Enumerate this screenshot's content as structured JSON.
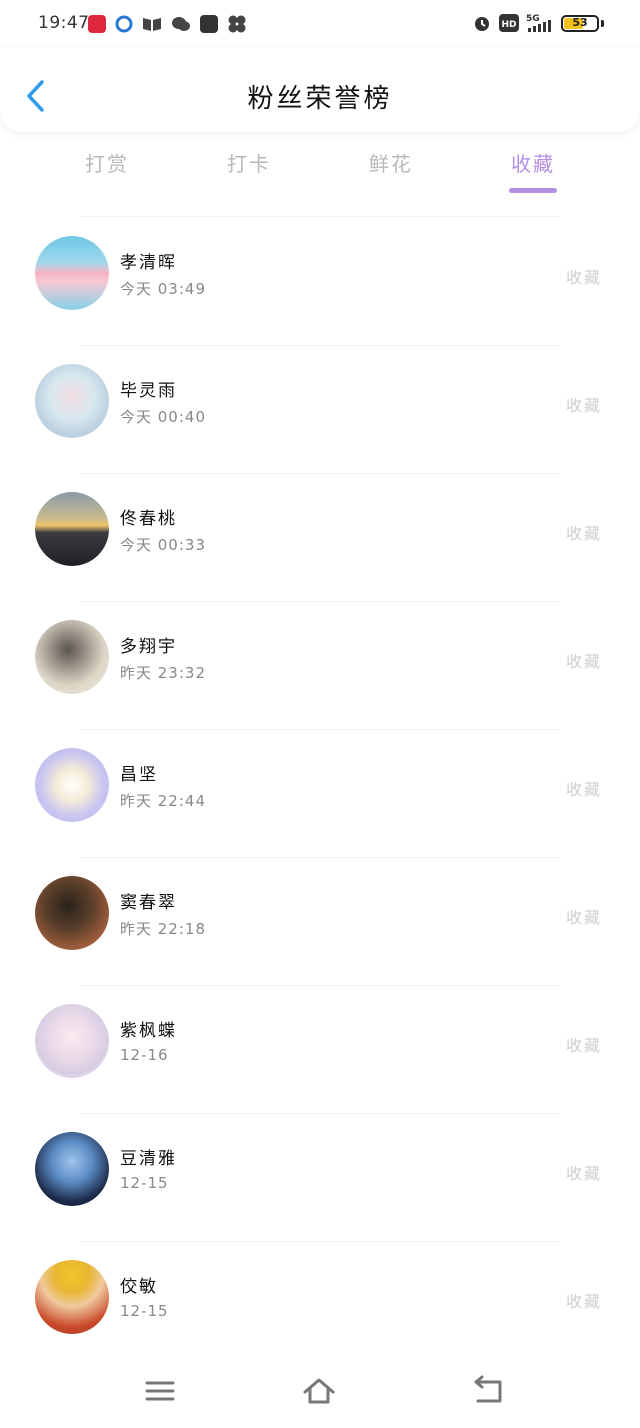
{
  "status_bar": {
    "time": "19:47",
    "left_icons": [
      "news-app-icon",
      "browser-icon",
      "book-icon",
      "wechat-icon",
      "music-icon",
      "fan-icon"
    ],
    "right_icons": [
      "alarm-icon",
      "hd-icon",
      "5g-signal-icon"
    ],
    "battery": "53"
  },
  "header": {
    "title": "粉丝荣誉榜"
  },
  "tabs": [
    {
      "label": "打赏",
      "active": false
    },
    {
      "label": "打卡",
      "active": false
    },
    {
      "label": "鲜花",
      "active": false
    },
    {
      "label": "收藏",
      "active": true
    }
  ],
  "list": [
    {
      "name": "孝清晖",
      "time": "今天 03:49",
      "action": "收藏"
    },
    {
      "name": "毕灵雨",
      "time": "今天 00:40",
      "action": "收藏"
    },
    {
      "name": "佟春桃",
      "time": "今天 00:33",
      "action": "收藏"
    },
    {
      "name": "多翔宇",
      "time": "昨天 23:32",
      "action": "收藏"
    },
    {
      "name": "昌坚",
      "time": "昨天 22:44",
      "action": "收藏"
    },
    {
      "name": "窦春翠",
      "time": "昨天 22:18",
      "action": "收藏"
    },
    {
      "name": "紫枫蝶",
      "time": "12-16",
      "action": "收藏"
    },
    {
      "name": "豆清雅",
      "time": "12-15",
      "action": "收藏"
    },
    {
      "name": "佼敏",
      "time": "12-15",
      "action": "收藏"
    }
  ],
  "colors": {
    "accent": "#b58fe3",
    "back": "#2f9bea",
    "muted": "#cfcfcf"
  },
  "bottom_nav": [
    "menu-icon",
    "home-icon",
    "back-nav-icon"
  ]
}
